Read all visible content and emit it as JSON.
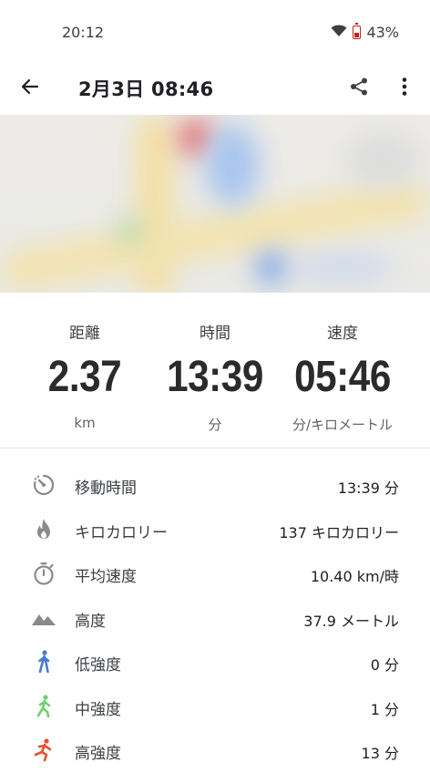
{
  "status_bar": {
    "time": "20:12",
    "battery": "43%"
  },
  "header": {
    "title": "2月3日 08:46"
  },
  "summary": [
    {
      "label": "距離",
      "value": "2.37",
      "unit": "km"
    },
    {
      "label": "時間",
      "value": "13:39",
      "unit": "分"
    },
    {
      "label": "速度",
      "value": "05:46",
      "unit": "分/キロメートル"
    }
  ],
  "details": [
    {
      "icon": "moving-time-icon",
      "label": "移動時間",
      "value": "13:39 分"
    },
    {
      "icon": "flame-icon",
      "label": "キロカロリー",
      "value": "137 キロカロリー"
    },
    {
      "icon": "stopwatch-icon",
      "label": "平均速度",
      "value": "10.40 km/時"
    },
    {
      "icon": "mountain-icon",
      "label": "高度",
      "value": "37.9 メートル"
    },
    {
      "icon": "walking-icon",
      "label": "低強度",
      "value": "0 分",
      "color": "#4a7bd1"
    },
    {
      "icon": "brisk-walking-icon",
      "label": "中強度",
      "value": "1 分",
      "color": "#6fcf6f"
    },
    {
      "icon": "running-icon",
      "label": "高強度",
      "value": "13 分",
      "color": "#e8512f"
    }
  ]
}
